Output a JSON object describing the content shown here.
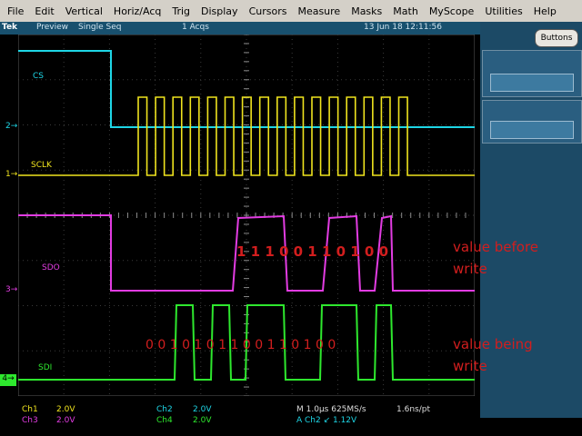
{
  "menu": [
    "File",
    "Edit",
    "Vertical",
    "Horiz/Acq",
    "Trig",
    "Display",
    "Cursors",
    "Measure",
    "Masks",
    "Math",
    "MyScope",
    "Utilities",
    "Help"
  ],
  "status": {
    "brand": "Tek",
    "mode": "Preview",
    "seq": "Single Seq",
    "acqs": "1 Acqs",
    "datetime": "13 Jun 18 12:11:56"
  },
  "buttons_label": "Buttons",
  "channels": {
    "cs": {
      "label": "CS",
      "marker": "2",
      "color": "#1ed6e6"
    },
    "sclk": {
      "label": "SCLK",
      "marker": "1",
      "color": "#f0e41e"
    },
    "sdo": {
      "label": "SDO",
      "marker": "3",
      "color": "#e23ce2"
    },
    "sdi": {
      "label": "SDI",
      "marker": "4",
      "color": "#2ee82e"
    }
  },
  "annotations": {
    "sdo_bits": "1 1 1 0 0 1 1 0 1   0 0",
    "sdo_text_line1": "value before",
    "sdo_text_line2": "write",
    "sdi_bits": "0 0 1 0 1 0 1 1 0 0 1 1 0 1   0 0",
    "sdi_text_line1": "value being",
    "sdi_text_line2": "write"
  },
  "readout": {
    "ch1": "Ch1",
    "ch1_v": "2.0V",
    "ch2": "Ch2",
    "ch2_v": "2.0V",
    "ch3": "Ch3",
    "ch3_v": "2.0V",
    "ch4": "Ch4",
    "ch4_v": "2.0V",
    "timebase": "M 1.0µs 625MS/s",
    "res": "1.6ns/pt",
    "trigger": "A  Ch2  ↙  1.12V"
  }
}
